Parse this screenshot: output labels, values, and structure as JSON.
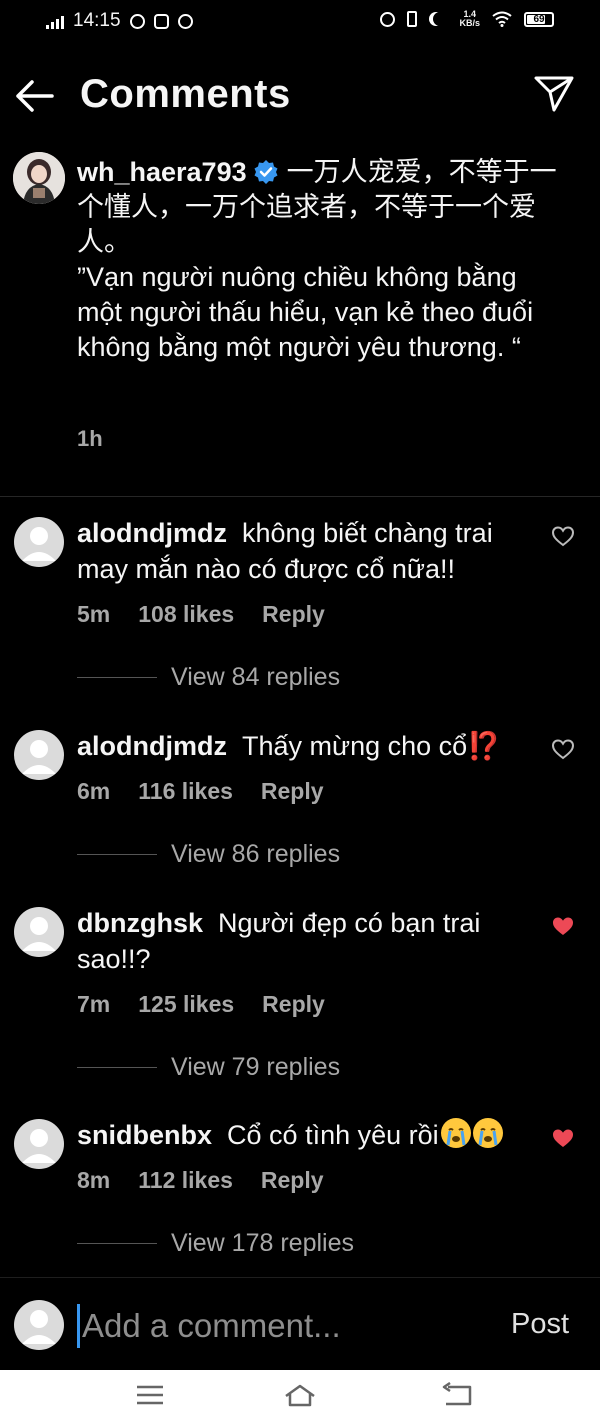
{
  "status_bar": {
    "time": "14:15",
    "net_speed_value": "1.4",
    "net_speed_unit": "KB/s",
    "battery": "69",
    "battery_level": 0.69
  },
  "header": {
    "title": "Comments",
    "back_icon": "arrow-left-icon",
    "send_icon": "paper-plane-icon"
  },
  "caption": {
    "username": "wh_haera793",
    "verified": true,
    "text_cn": "一万人宠爱，不等于一个懂人，一万个追求者，不等于一个爱人。",
    "text_vi": "”Vạn người nuông chiều không bằng một người thấu hiểu, vạn kẻ theo đuổi không bằng một người yêu thương. “",
    "time": "1h"
  },
  "comments": [
    {
      "username": "alodndjmdz",
      "text": "không biết chàng trai may mắn nào có được cổ nữa!!",
      "time": "5m",
      "likes": "108 likes",
      "reply_label": "Reply",
      "view_replies": "View 84 replies",
      "liked": false
    },
    {
      "username": "alodndjmdz",
      "text": "Thấy mừng cho cổ⁉️",
      "time": "6m",
      "likes": "116 likes",
      "reply_label": "Reply",
      "view_replies": "View 86 replies",
      "liked": false
    },
    {
      "username": "dbnzghsk",
      "text": "Người đẹp có bạn trai sao!!?",
      "time": "7m",
      "likes": "125 likes",
      "reply_label": "Reply",
      "view_replies": "View 79 replies",
      "liked": true
    },
    {
      "username": "snidbenbx",
      "text": "Cổ có tình yêu rồi",
      "time": "8m",
      "likes": "112 likes",
      "reply_label": "Reply",
      "view_replies": "View 178 replies",
      "liked": true
    }
  ],
  "composer": {
    "placeholder": "Add a comment...",
    "post_label": "Post"
  },
  "colors": {
    "background": "#000000",
    "secondary_text": "#a8a8a8",
    "verified_blue": "#3897f0",
    "liked_red": "#ed4956"
  }
}
